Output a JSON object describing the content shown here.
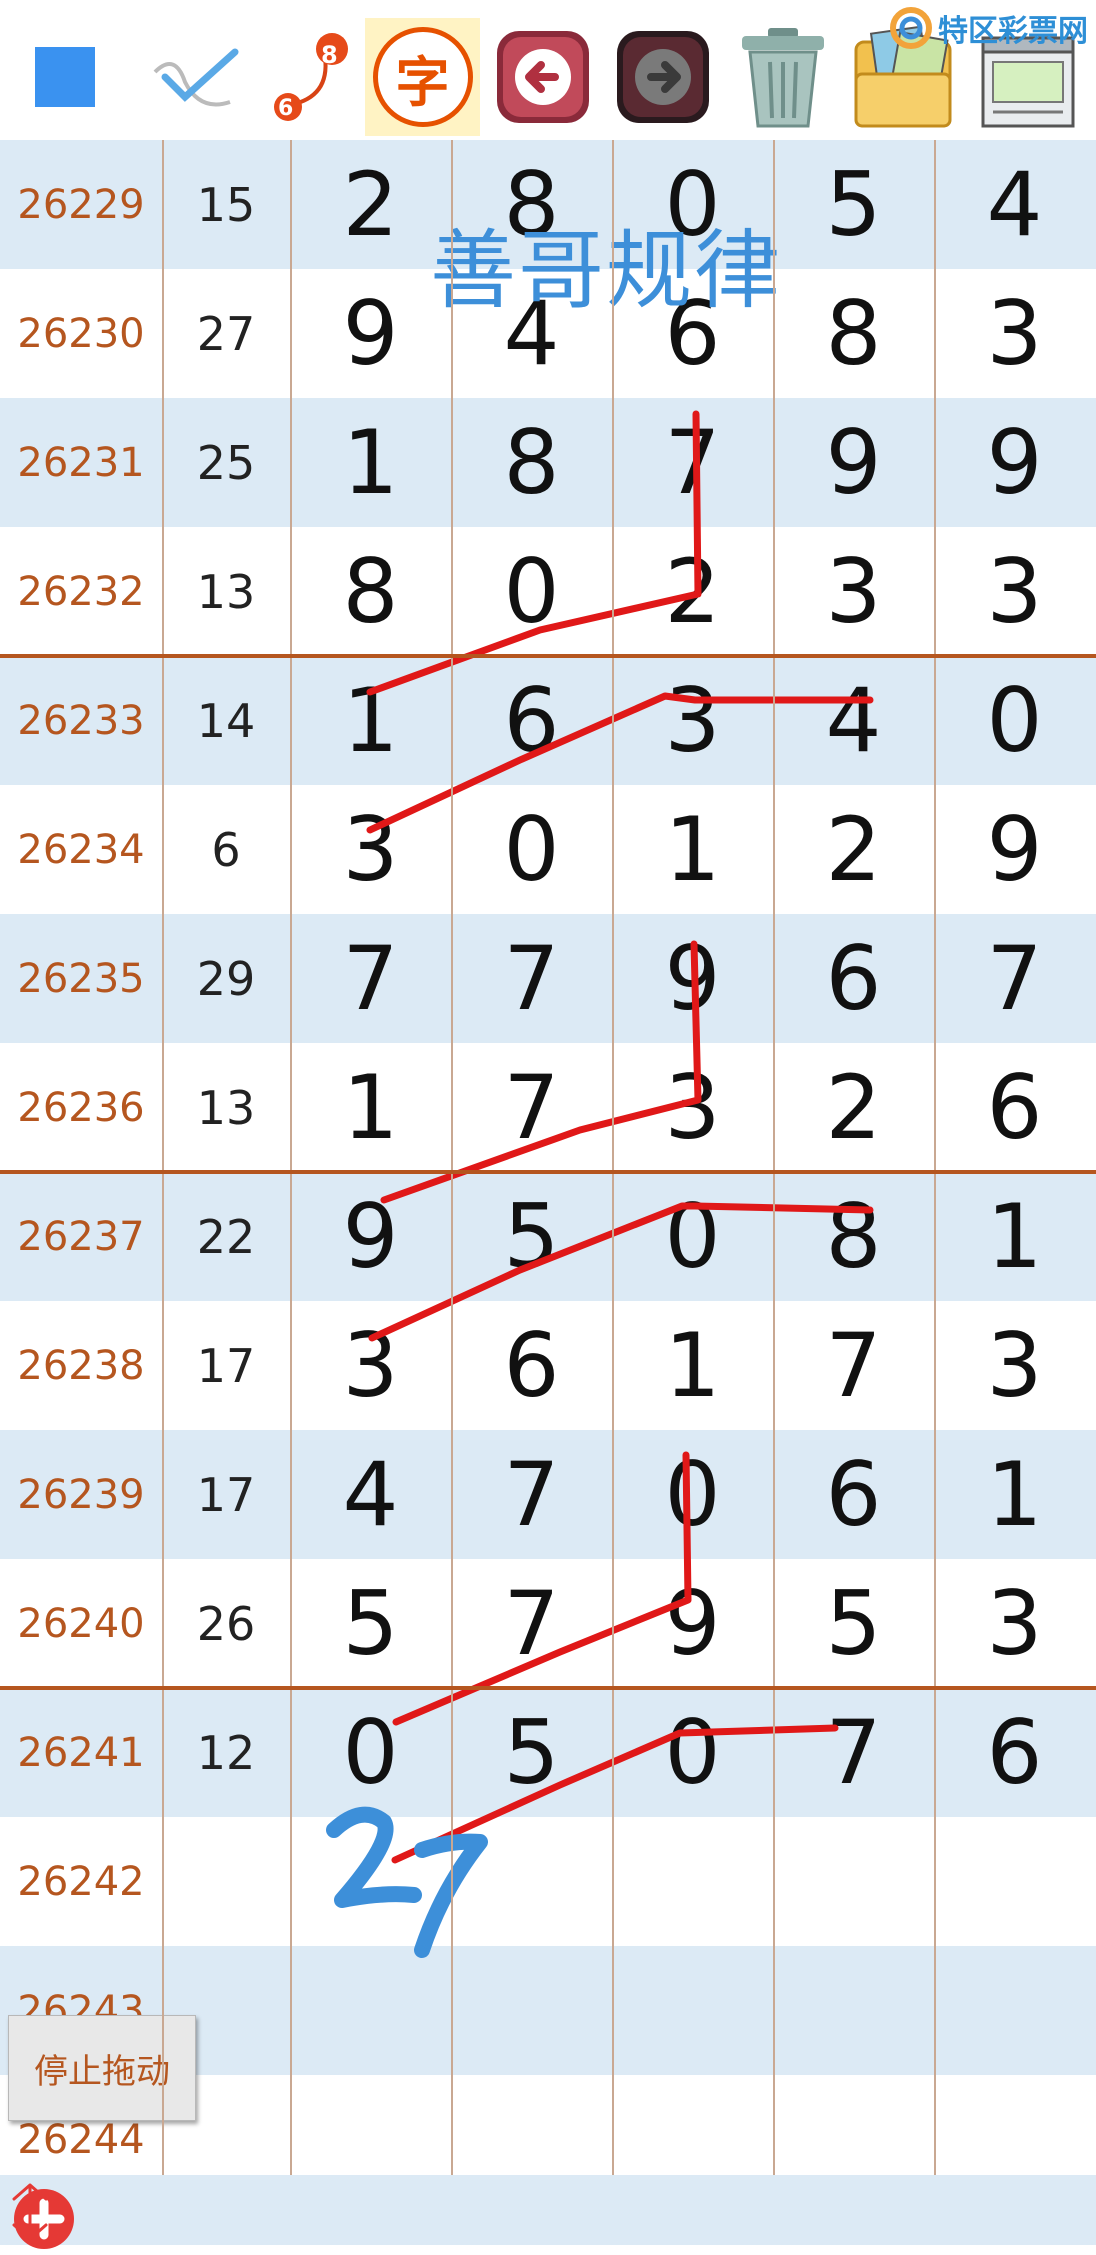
{
  "toolbar": {
    "tools": [
      {
        "id": "square",
        "icon": "blue-square-icon"
      },
      {
        "id": "pen",
        "icon": "pen-check-icon"
      },
      {
        "id": "link",
        "icon": "numbered-link-icon",
        "label_a": "8",
        "label_b": "6"
      },
      {
        "id": "text",
        "icon": "text-char-icon",
        "label": "字"
      },
      {
        "id": "undo",
        "icon": "back-arrow-icon"
      },
      {
        "id": "redo",
        "icon": "forward-arrow-icon"
      },
      {
        "id": "trash",
        "icon": "trash-icon"
      },
      {
        "id": "folder",
        "icon": "photo-folder-icon"
      },
      {
        "id": "notes",
        "icon": "notebook-icon"
      }
    ]
  },
  "watermark": {
    "text": "特区彩票网",
    "icon": "swirl-logo-icon"
  },
  "title_overlay": "善哥规律",
  "rows": [
    {
      "issue": "26229",
      "sum": "15",
      "digits": [
        "2",
        "8",
        "0",
        "5",
        "4"
      ]
    },
    {
      "issue": "26230",
      "sum": "27",
      "digits": [
        "9",
        "4",
        "6",
        "8",
        "3"
      ]
    },
    {
      "issue": "26231",
      "sum": "25",
      "digits": [
        "1",
        "8",
        "7",
        "9",
        "9"
      ]
    },
    {
      "issue": "26232",
      "sum": "13",
      "digits": [
        "8",
        "0",
        "2",
        "3",
        "3"
      ]
    },
    {
      "issue": "26233",
      "sum": "14",
      "digits": [
        "1",
        "6",
        "3",
        "4",
        "0"
      ]
    },
    {
      "issue": "26234",
      "sum": "6",
      "digits": [
        "3",
        "0",
        "1",
        "2",
        "9"
      ]
    },
    {
      "issue": "26235",
      "sum": "29",
      "digits": [
        "7",
        "7",
        "9",
        "6",
        "7"
      ]
    },
    {
      "issue": "26236",
      "sum": "13",
      "digits": [
        "1",
        "7",
        "3",
        "2",
        "6"
      ]
    },
    {
      "issue": "26237",
      "sum": "22",
      "digits": [
        "9",
        "5",
        "0",
        "8",
        "1"
      ]
    },
    {
      "issue": "26238",
      "sum": "17",
      "digits": [
        "3",
        "6",
        "1",
        "7",
        "3"
      ]
    },
    {
      "issue": "26239",
      "sum": "17",
      "digits": [
        "4",
        "7",
        "0",
        "6",
        "1"
      ]
    },
    {
      "issue": "26240",
      "sum": "26",
      "digits": [
        "5",
        "7",
        "9",
        "5",
        "3"
      ]
    },
    {
      "issue": "26241",
      "sum": "12",
      "digits": [
        "0",
        "5",
        "0",
        "7",
        "6"
      ]
    },
    {
      "issue": "26242",
      "sum": "",
      "digits": [
        "",
        "",
        "",
        "",
        ""
      ]
    },
    {
      "issue": "26243",
      "sum": "",
      "digits": [
        "",
        "",
        "",
        "",
        ""
      ]
    },
    {
      "issue": "26244",
      "sum": "",
      "digits": [
        "",
        "",
        "",
        "",
        ""
      ]
    }
  ],
  "annotation": "27",
  "stop_drag_label": "停止拖动",
  "bottom": {
    "add_icon": "plus-circle-icon",
    "scroll_icon": "up-down-arrow-icon"
  },
  "colors": {
    "issue_text": "#b5561f",
    "row_blue": "#dceaf5",
    "separator": "#b5561f",
    "ink_red": "#e01818",
    "ink_blue": "#3d8fd9",
    "title_blue": "#3d8fd9"
  }
}
